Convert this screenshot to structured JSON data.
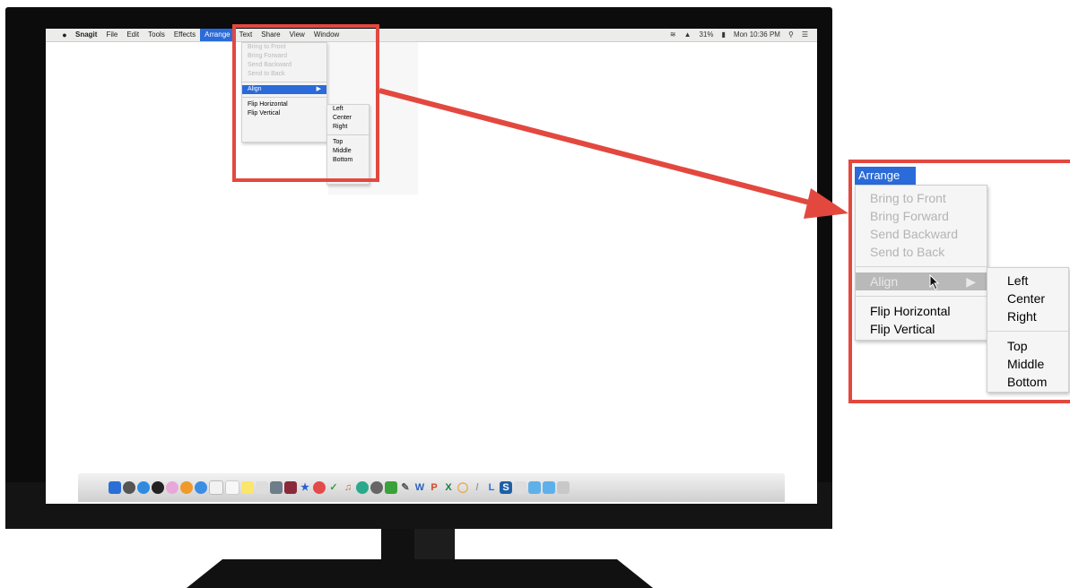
{
  "menubar": {
    "apple_icon": "apple-icon",
    "items": [
      "Snagit",
      "File",
      "Edit",
      "Tools",
      "Effects",
      "Arrange",
      "Text",
      "Share",
      "View",
      "Window"
    ],
    "active_item": "Arrange",
    "status_right": [
      "31%",
      "Mon 10:36 PM"
    ]
  },
  "arrange_menu": {
    "title": "Arrange",
    "disabled_items": [
      "Bring to Front",
      "Bring Forward",
      "Send Backward",
      "Send to Back"
    ],
    "align_label": "Align",
    "flip_items": [
      "Flip Horizontal",
      "Flip Vertical"
    ]
  },
  "align_submenu": {
    "horizontal": [
      "Left",
      "Center",
      "Right"
    ],
    "vertical": [
      "Top",
      "Middle",
      "Bottom"
    ]
  },
  "submenu_arrow": "▶",
  "colors": {
    "highlight_blue": "#2a6bd9",
    "callout_red": "#e3483f",
    "monitor_black": "#0c0c0c"
  },
  "dock_letters": [
    "W",
    "P",
    "X",
    "L",
    "S"
  ]
}
